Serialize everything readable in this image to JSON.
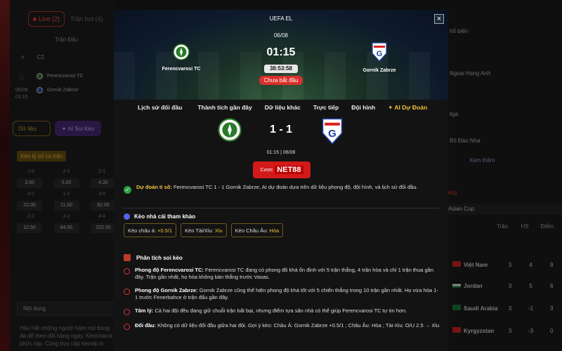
{
  "background": {
    "tabs": {
      "live": "Live (2)",
      "hot": "Trận hot (4)"
    },
    "header": "Trận Đấu",
    "league": "C2",
    "match": {
      "home": "Ferencvarosi TC",
      "away": "Gornik Zabrze",
      "date": "06/08",
      "time": "01:15"
    },
    "buttons": {
      "data": "Dữ liệu",
      "ai": "AI Soi Kèo"
    },
    "section": "Kèo tỷ số cả trận",
    "grid": [
      [
        "1-0",
        "2-0",
        "2-1"
      ],
      [
        "3.50",
        "5.00",
        "4.30"
      ],
      [
        "0-2",
        "1-2",
        "3-0"
      ],
      [
        "22.00",
        "11.00",
        "82.00"
      ],
      [
        "2-2",
        "3-2",
        "4-4"
      ],
      [
        "12.50",
        "84.00",
        "222.00"
      ]
    ],
    "content_label": "Nội dung",
    "content_text": "Hầu hết những người hâm mộ bóng đá để theo dõi hàng ngày. Keonhacai phức tạp. Cùng truy cập keovip.tv",
    "right": {
      "items": [
        "hổ biến",
        "Ngoại Hạng Anh",
        "liga",
        "Bồ Đào Nha"
      ],
      "more": "Xem thêm",
      "league": "Bảng",
      "cup": "Asian Cup",
      "headers": [
        "Trận",
        "HS",
        "Điểm"
      ],
      "rows": [
        {
          "team": "Việt Nam",
          "p": "3",
          "gd": "4",
          "pts": "9"
        },
        {
          "team": "Jordan",
          "p": "3",
          "gd": "5",
          "pts": "6"
        },
        {
          "team": "Saudi Arabia",
          "p": "3",
          "gd": "-1",
          "pts": "3"
        },
        {
          "team": "Kyrgyzstan",
          "p": "3",
          "gd": "-3",
          "pts": "0"
        }
      ]
    }
  },
  "modal": {
    "competition": "UEFA EL",
    "date": "06/08",
    "time": "01:15",
    "countdown": "38:53:58",
    "status": "Chưa bắt đầu",
    "home": "Ferencvarosi TC",
    "away": "Gornik Zabrze",
    "tabs": [
      "Lịch sử đối đầu",
      "Thành tích gần đây",
      "Dữ liệu khác",
      "Trực tiếp",
      "Đội hình"
    ],
    "ai_tab": "AI Dự Đoán",
    "score": "1 - 1",
    "kickoff": "01:15 | 06/08",
    "bet": {
      "prefix": "Cược",
      "brand": "NET88"
    },
    "prediction": {
      "label": "Dự đoán tỉ số:",
      "text": "Ferencvarosi TC 1 - 1 Gornik Zabrze, AI dự đoán dựa trên dữ liệu phong độ, đội hình, và lịch sử đối đầu."
    },
    "odds_title": "Kèo nhà cái tham khảo",
    "odds": [
      {
        "label": "Kèo châu á:",
        "value": "+0.5/1"
      },
      {
        "label": "Kèo Tài/Xỉu:",
        "value": "Xỉu"
      },
      {
        "label": "Kèo Châu Âu:",
        "value": "Hòa"
      }
    ],
    "analysis_title": "Phân tích soi kèo",
    "analysis": [
      {
        "key": "Phong độ Ferencvarosi TC:",
        "text": "Ferencvarosi TC đang có phong độ khá ổn định với 5 trận thắng, 4 trận hòa và chỉ 1 trận thua gần đây. Trận gần nhất, họ hòa không bàn thắng trước Vasas."
      },
      {
        "key": "Phong độ Gornik Zabrze:",
        "text": "Gornik Zabrze cũng thể hiện phong độ khá tốt với 5 chiến thắng trong 10 trận gần nhất. Họ vừa hòa 1-1 trước Fenerbahce ở trận đấu gần đây."
      },
      {
        "key": "Tâm lý:",
        "text": "Cả hai đội đều đang giữ chuỗi trận bất bại, nhưng điểm tựa sân nhà có thể giúp Ferencvarosi TC tự tin hơn."
      },
      {
        "key": "Đối đầu:",
        "text": "Không có dữ liệu đối đầu giữa hai đội. Gợi ý kèo: Châu Á: Gornik Zabrze +0.5/1 ; Châu Âu: Hòa ; Tài-Xỉu: O/U 2.5 → Xỉu"
      }
    ]
  }
}
